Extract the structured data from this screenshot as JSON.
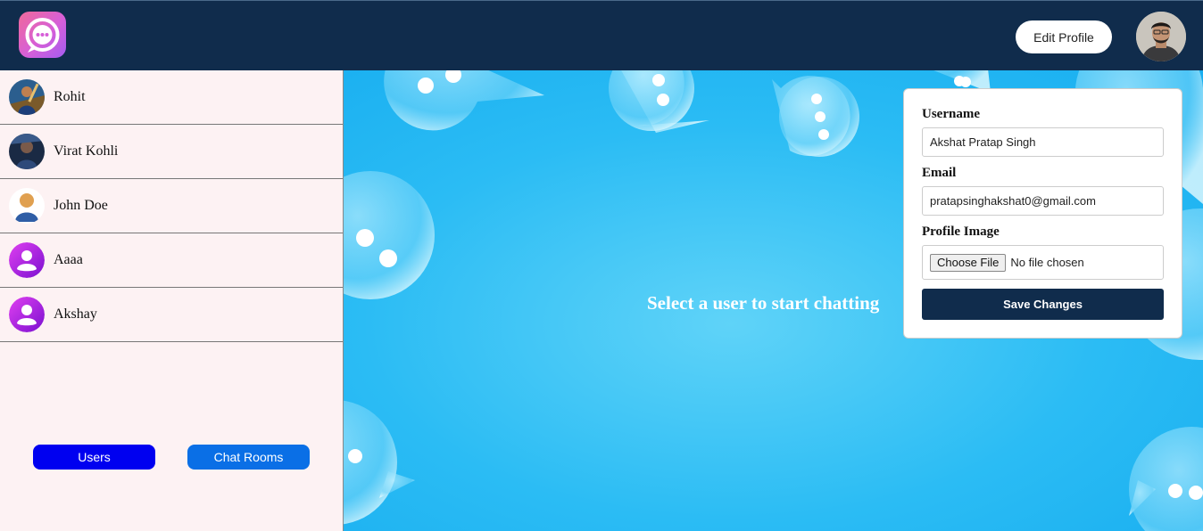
{
  "header": {
    "logo_icon": "chat-bubble-icon",
    "edit_profile_label": "Edit Profile",
    "avatar_icon": "user-photo"
  },
  "sidebar": {
    "users": [
      {
        "name": "Rohit",
        "avatar": "photo"
      },
      {
        "name": "Virat Kohli",
        "avatar": "photo"
      },
      {
        "name": "John Doe",
        "avatar": "default-person"
      },
      {
        "name": "Aaaa",
        "avatar": "default-purple"
      },
      {
        "name": "Akshay",
        "avatar": "default-purple"
      }
    ],
    "tabs": {
      "users_label": "Users",
      "chat_rooms_label": "Chat Rooms"
    }
  },
  "chat": {
    "placeholder_text": "Select a user to start chatting"
  },
  "profile_form": {
    "username_label": "Username",
    "username_value": "Akshat Pratap Singh",
    "email_label": "Email",
    "email_value": "pratapsinghakshat0@gmail.com",
    "image_label": "Profile Image",
    "choose_file_label": "Choose File",
    "no_file_text": "No file chosen",
    "save_label": "Save Changes"
  },
  "colors": {
    "header_bg": "#102c4c",
    "sidebar_bg": "#fdf2f3",
    "users_tab": "#0000f0",
    "chat_rooms_tab": "#0a6fe6",
    "chat_bg": "#2bbcf4"
  }
}
